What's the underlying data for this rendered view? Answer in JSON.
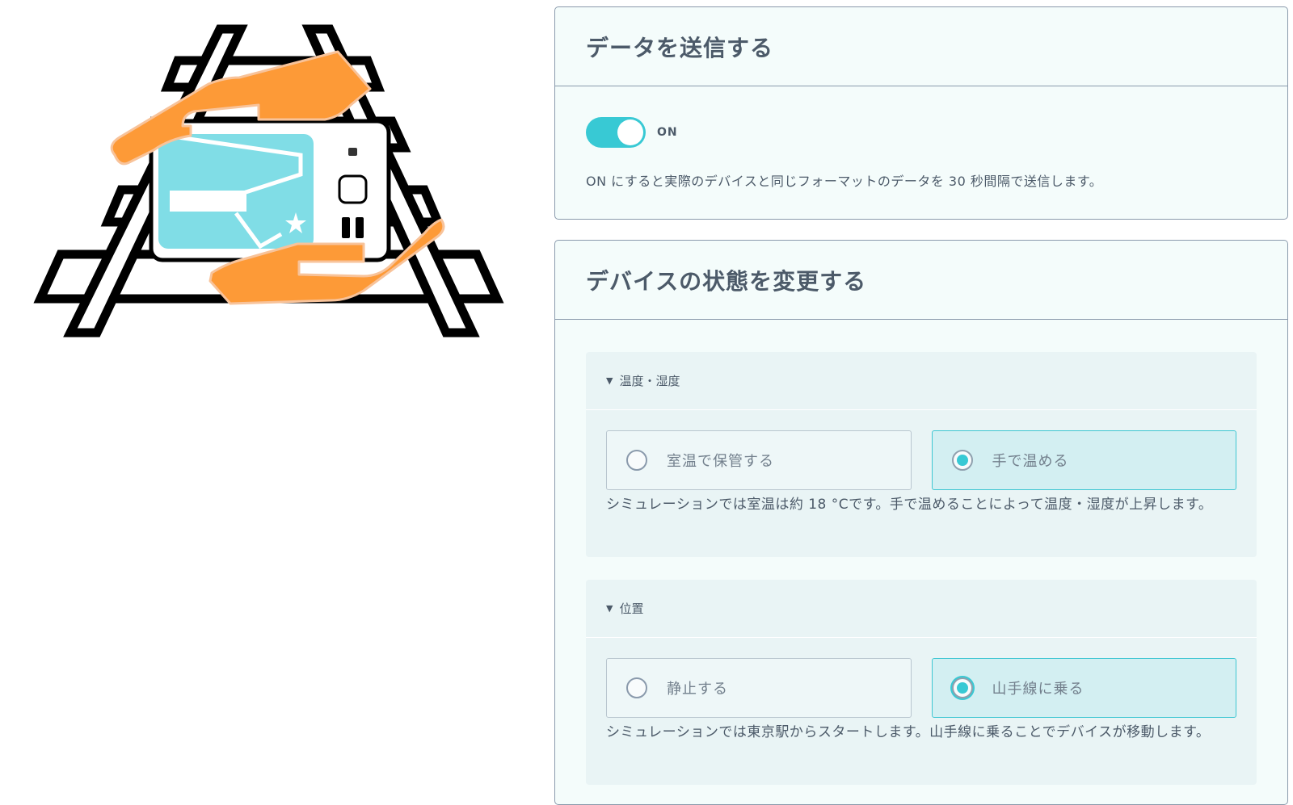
{
  "logo": {
    "name": "device-on-rails-logo"
  },
  "send_card": {
    "title": "データを送信する",
    "toggle_state": "ON",
    "description": "ON にすると実際のデバイスと同じフォーマットのデータを 30 秒間隔で送信します。"
  },
  "device_card": {
    "title": "デバイスの状態を変更する",
    "sections": [
      {
        "heading": "温度・湿度",
        "options": [
          {
            "label": "室温で保管する",
            "selected": false
          },
          {
            "label": "手で温める",
            "selected": true
          }
        ],
        "description": "シミュレーションでは室温は約 18 °Cです。手で温めることによって温度・湿度が上昇します。"
      },
      {
        "heading": "位置",
        "options": [
          {
            "label": "静止する",
            "selected": false
          },
          {
            "label": "山手線に乗る",
            "selected": true
          }
        ],
        "description": "シミュレーションでは東京駅からスタートします。山手線に乗ることでデバイスが移動します。"
      }
    ]
  },
  "colors": {
    "accent": "#38c9d4",
    "hand": "#fd9a37",
    "screen": "#80dde6",
    "card_bg": "#f4fcfb"
  }
}
